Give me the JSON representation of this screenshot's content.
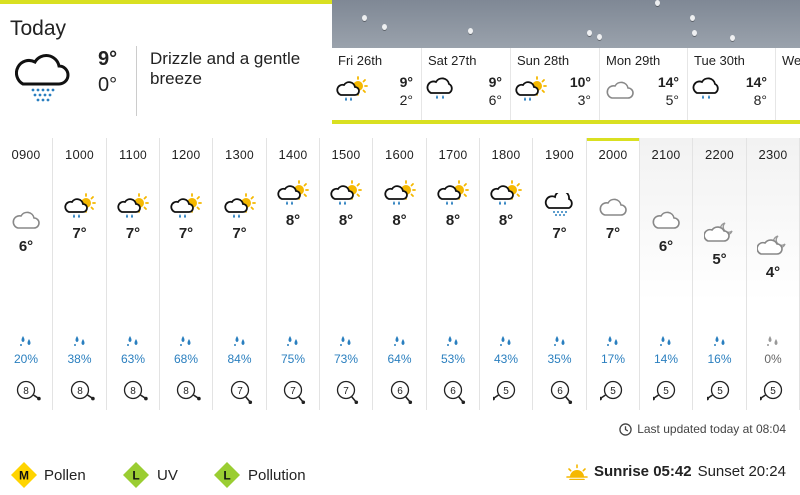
{
  "today": {
    "title": "Today",
    "high": "9°",
    "low": "0°",
    "description": "Drizzle and a gentle breeze",
    "icon": "drizzle-icon"
  },
  "days": [
    {
      "name": "Fri 26th",
      "high": "9°",
      "low": "2°",
      "icon": "light-rain-sun-icon"
    },
    {
      "name": "Sat 27th",
      "high": "9°",
      "low": "6°",
      "icon": "light-rain-icon"
    },
    {
      "name": "Sun 28th",
      "high": "10°",
      "low": "3°",
      "icon": "light-rain-sun-icon"
    },
    {
      "name": "Mon 29th",
      "high": "14°",
      "low": "5°",
      "icon": "cloud-icon"
    },
    {
      "name": "Tue 30th",
      "high": "14°",
      "low": "8°",
      "icon": "light-rain-icon"
    },
    {
      "name": "We",
      "high": "",
      "low": "",
      "icon": ""
    }
  ],
  "hours": [
    {
      "h": "09",
      "m": "00",
      "temp": "6°",
      "icon": "cloud",
      "pct": "20%",
      "wind": "8"
    },
    {
      "h": "10",
      "m": "00",
      "temp": "7°",
      "icon": "rain-sun",
      "pct": "38%",
      "wind": "8"
    },
    {
      "h": "11",
      "m": "00",
      "temp": "7°",
      "icon": "rain-sun",
      "pct": "63%",
      "wind": "8"
    },
    {
      "h": "12",
      "m": "00",
      "temp": "7°",
      "icon": "rain-sun",
      "pct": "68%",
      "wind": "8"
    },
    {
      "h": "13",
      "m": "00",
      "temp": "7°",
      "icon": "rain-sun",
      "pct": "84%",
      "wind": "7"
    },
    {
      "h": "14",
      "m": "00",
      "temp": "8°",
      "icon": "rain-sun",
      "pct": "75%",
      "wind": "7"
    },
    {
      "h": "15",
      "m": "00",
      "temp": "8°",
      "icon": "rain-sun",
      "pct": "73%",
      "wind": "7"
    },
    {
      "h": "16",
      "m": "00",
      "temp": "8°",
      "icon": "rain-sun",
      "pct": "64%",
      "wind": "6"
    },
    {
      "h": "17",
      "m": "00",
      "temp": "8°",
      "icon": "rain-sun",
      "pct": "53%",
      "wind": "6"
    },
    {
      "h": "18",
      "m": "00",
      "temp": "8°",
      "icon": "rain-sun",
      "pct": "43%",
      "wind": "5"
    },
    {
      "h": "19",
      "m": "00",
      "temp": "7°",
      "icon": "drizzle",
      "pct": "35%",
      "wind": "6"
    },
    {
      "h": "20",
      "m": "00",
      "temp": "7°",
      "icon": "cloud",
      "pct": "17%",
      "wind": "5"
    },
    {
      "h": "21",
      "m": "00",
      "temp": "6°",
      "icon": "cloud",
      "pct": "14%",
      "wind": "5"
    },
    {
      "h": "22",
      "m": "00",
      "temp": "5°",
      "icon": "cloud-moon",
      "pct": "16%",
      "wind": "5"
    },
    {
      "h": "23",
      "m": "00",
      "temp": "4°",
      "icon": "cloud-moon",
      "pct": "0%",
      "wind": "5"
    }
  ],
  "updated": "Last updated today at 08:04",
  "footer": {
    "pollen": {
      "level": "M",
      "label": "Pollen",
      "color": "#ffd400"
    },
    "uv": {
      "level": "L",
      "label": "UV",
      "color": "#9acd32"
    },
    "pollution": {
      "level": "L",
      "label": "Pollution",
      "color": "#9acd32"
    },
    "sunrise_label": "Sunrise",
    "sunrise": "05:42",
    "sunset_label": "Sunset",
    "sunset": "20:24"
  },
  "colors": {
    "accent": "#d9e021",
    "rain": "#2a7fbf",
    "sun": "#f5b800"
  }
}
